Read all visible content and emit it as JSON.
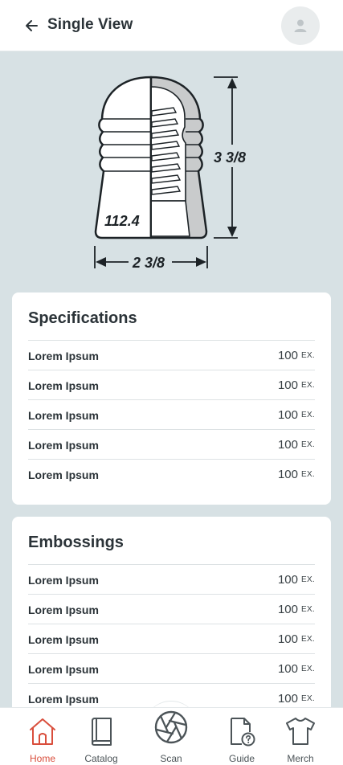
{
  "header": {
    "title": "Single View",
    "back_icon": "arrow-left-icon",
    "avatar_icon": "user-icon"
  },
  "illustration": {
    "part_number": "112.4",
    "height_label": "3 3/8",
    "width_label": "2 3/8"
  },
  "specifications": {
    "title": "Specifications",
    "rows": [
      {
        "label": "Lorem Ipsum",
        "value": "100",
        "unit": "EX."
      },
      {
        "label": "Lorem Ipsum",
        "value": "100",
        "unit": "EX."
      },
      {
        "label": "Lorem Ipsum",
        "value": "100",
        "unit": "EX."
      },
      {
        "label": "Lorem Ipsum",
        "value": "100",
        "unit": "EX."
      },
      {
        "label": "Lorem Ipsum",
        "value": "100",
        "unit": "EX."
      }
    ]
  },
  "embossings": {
    "title": "Embossings",
    "rows": [
      {
        "label": "Lorem Ipsum",
        "value": "100",
        "unit": "EX."
      },
      {
        "label": "Lorem Ipsum",
        "value": "100",
        "unit": "EX."
      },
      {
        "label": "Lorem Ipsum",
        "value": "100",
        "unit": "EX."
      },
      {
        "label": "Lorem Ipsum",
        "value": "100",
        "unit": "EX."
      },
      {
        "label": "Lorem Ipsum",
        "value": "100",
        "unit": "EX."
      }
    ]
  },
  "nav": {
    "active": "home",
    "active_color": "#d94e3c",
    "items": [
      {
        "label": "Home",
        "icon": "home-icon"
      },
      {
        "label": "Catalog",
        "icon": "book-icon"
      },
      {
        "label": "Scan",
        "icon": "camera-aperture-icon"
      },
      {
        "label": "Guide",
        "icon": "file-question-icon"
      },
      {
        "label": "Merch",
        "icon": "tshirt-icon"
      }
    ]
  }
}
